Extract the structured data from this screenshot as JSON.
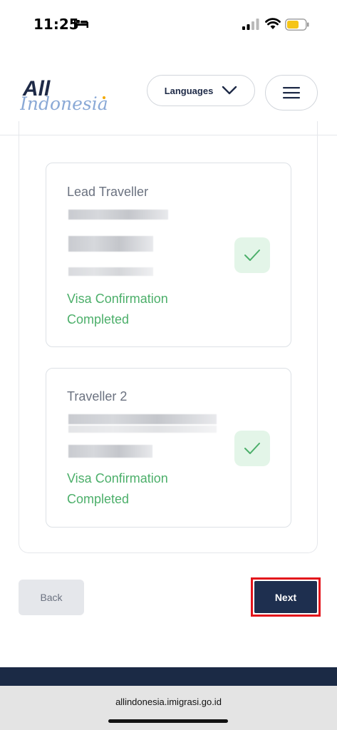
{
  "status_bar": {
    "time": "11:25"
  },
  "header": {
    "logo_text_top": "All",
    "logo_text_bottom": "Indonesia",
    "languages_label": "Languages"
  },
  "travellers": [
    {
      "title": "Lead Traveller",
      "status_line1": "Visa Confirmation",
      "status_line2": "Completed"
    },
    {
      "title": "Traveller 2",
      "status_line1": "Visa Confirmation",
      "status_line2": "Completed"
    }
  ],
  "actions": {
    "back_label": "Back",
    "next_label": "Next"
  },
  "browser": {
    "url": "allindonesia.imigrasi.go.id"
  },
  "colors": {
    "navy": "#1e2f4f",
    "success_green": "#4caf6a",
    "highlight_red": "#e3141b"
  }
}
